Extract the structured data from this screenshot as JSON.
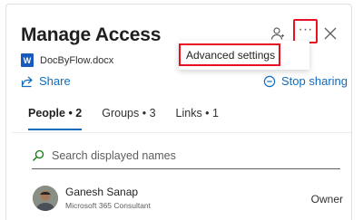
{
  "header": {
    "title": "Manage Access",
    "more_label": "···"
  },
  "menu": {
    "items": [
      {
        "label": "Advanced settings"
      }
    ]
  },
  "file": {
    "icon": "word-document-icon",
    "icon_letter": "W",
    "name": "DocByFlow.docx"
  },
  "actions": {
    "share_label": "Share",
    "stop_sharing_label": "Stop sharing"
  },
  "tabs": [
    {
      "label": "People • 2",
      "active": true
    },
    {
      "label": "Groups • 3",
      "active": false
    },
    {
      "label": "Links • 1",
      "active": false
    }
  ],
  "search": {
    "placeholder": "Search displayed names",
    "value": ""
  },
  "people": [
    {
      "name": "Ganesh Sanap",
      "title": "Microsoft 365 Consultant",
      "role": "Owner"
    }
  ],
  "colors": {
    "accent": "#0f6cbd",
    "highlight_border": "#e81123",
    "word_blue": "#185abd"
  }
}
